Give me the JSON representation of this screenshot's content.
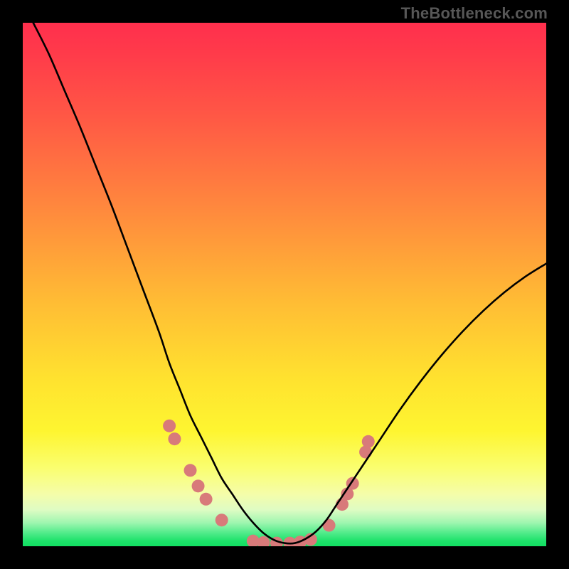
{
  "watermark": "TheBottleneck.com",
  "chart_data": {
    "type": "line",
    "title": "",
    "xlabel": "",
    "ylabel": "",
    "xlim": [
      0,
      100
    ],
    "ylim": [
      0,
      100
    ],
    "grid": false,
    "legend": false,
    "series": [
      {
        "name": "bottleneck-curve",
        "color": "#000000",
        "x": [
          2,
          5,
          8,
          11,
          14,
          17,
          20,
          23,
          26,
          28,
          30,
          32,
          34,
          36,
          38,
          40,
          42,
          44,
          46,
          48,
          50,
          52,
          54,
          56,
          58,
          60,
          64,
          68,
          72,
          76,
          80,
          84,
          88,
          92,
          96,
          100
        ],
        "y": [
          100,
          94,
          87,
          80,
          72.5,
          65,
          57,
          49,
          41,
          35,
          30,
          25,
          21,
          17,
          13,
          10,
          7,
          4.5,
          2.5,
          1.2,
          0.6,
          0.6,
          1.4,
          2.8,
          5,
          8,
          14,
          20,
          26,
          31.5,
          36.5,
          41,
          45,
          48.5,
          51.5,
          54
        ]
      }
    ],
    "markers": [
      {
        "name": "left-dot-1",
        "x": 28.0,
        "y": 23.0
      },
      {
        "name": "left-dot-2",
        "x": 29.0,
        "y": 20.5
      },
      {
        "name": "left-dot-3",
        "x": 32.0,
        "y": 14.5
      },
      {
        "name": "left-dot-4",
        "x": 33.5,
        "y": 11.5
      },
      {
        "name": "left-dot-5",
        "x": 35.0,
        "y": 9.0
      },
      {
        "name": "left-dot-6",
        "x": 38.0,
        "y": 5.0
      },
      {
        "name": "trough-dot-1",
        "x": 44.0,
        "y": 1.0
      },
      {
        "name": "trough-dot-2",
        "x": 46.0,
        "y": 0.7
      },
      {
        "name": "trough-dot-3",
        "x": 48.5,
        "y": 0.6
      },
      {
        "name": "trough-dot-4",
        "x": 51.0,
        "y": 0.6
      },
      {
        "name": "trough-dot-5",
        "x": 53.0,
        "y": 0.8
      },
      {
        "name": "trough-dot-6",
        "x": 55.0,
        "y": 1.3
      },
      {
        "name": "right-dot-1",
        "x": 58.5,
        "y": 4.0
      },
      {
        "name": "right-dot-2",
        "x": 61.0,
        "y": 8.0
      },
      {
        "name": "right-dot-3",
        "x": 62.0,
        "y": 10.0
      },
      {
        "name": "right-dot-4",
        "x": 63.0,
        "y": 12.0
      },
      {
        "name": "right-dot-5",
        "x": 65.5,
        "y": 18.0
      },
      {
        "name": "right-dot-6",
        "x": 66.0,
        "y": 20.0
      }
    ],
    "marker_style": {
      "color": "#d87a7a",
      "radius_px": 9
    }
  }
}
